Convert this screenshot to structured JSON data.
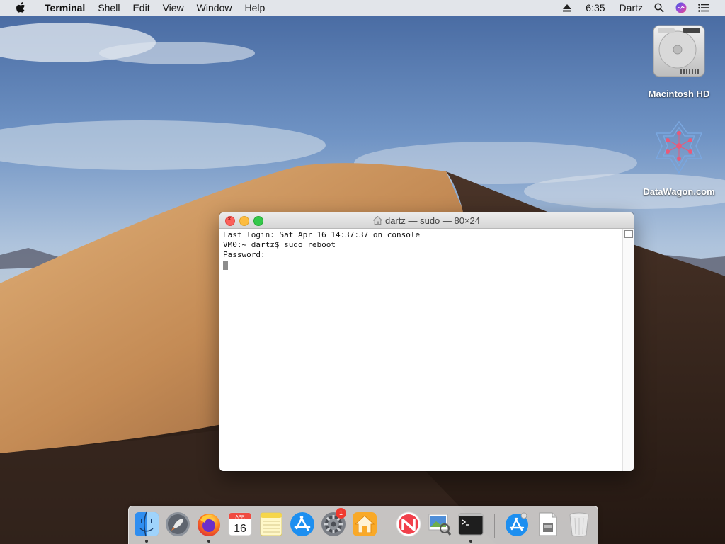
{
  "menubar": {
    "app_name": "Terminal",
    "menus": [
      "Shell",
      "Edit",
      "View",
      "Window",
      "Help"
    ],
    "time": "6:35",
    "user": "Dartz"
  },
  "desktop_icons": [
    {
      "label": "Macintosh HD",
      "icon": "hard-drive-icon"
    },
    {
      "label": "DataWagon.com",
      "icon": "datawagon-logo-icon"
    }
  ],
  "terminal": {
    "title": "dartz — sudo — 80×24",
    "lines": [
      "Last login: Sat Apr 16 14:37:37 on console",
      "VM0:~ dartz$ sudo reboot",
      "Password:"
    ]
  },
  "dock": {
    "items": [
      {
        "name": "finder",
        "running": true
      },
      {
        "name": "launchpad",
        "running": false
      },
      {
        "name": "firefox",
        "running": true
      },
      {
        "name": "calendar",
        "running": false,
        "month": "APR",
        "day": "16"
      },
      {
        "name": "notes",
        "running": false
      },
      {
        "name": "app-store",
        "running": false
      },
      {
        "name": "system-preferences",
        "running": false,
        "badge": "1"
      },
      {
        "name": "home",
        "running": false
      },
      {
        "name": "news",
        "running": false
      },
      {
        "name": "preview",
        "running": false
      },
      {
        "name": "terminal",
        "running": true
      },
      {
        "name": "app-store-downloads",
        "running": false
      },
      {
        "name": "documents",
        "running": false
      },
      {
        "name": "trash",
        "running": false
      }
    ]
  },
  "colors": {
    "close": "#fc605b",
    "minimize": "#fdbc40",
    "zoom": "#34c84a"
  }
}
